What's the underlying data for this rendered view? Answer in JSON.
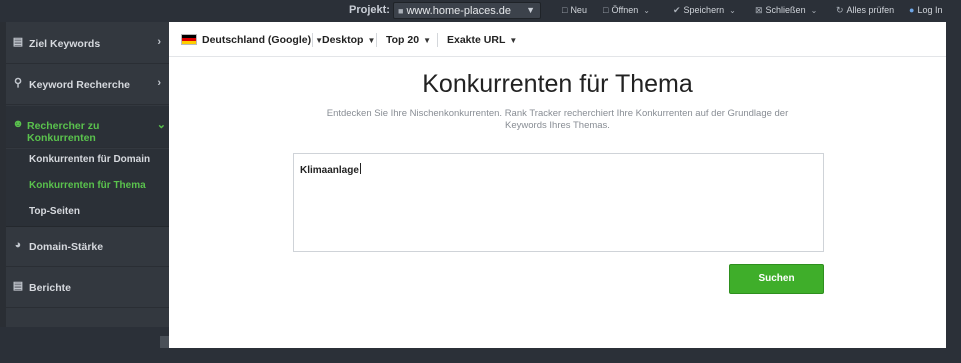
{
  "topbar": {
    "project_label": "Projekt:",
    "project_value": "www.home-places.de",
    "items": [
      {
        "label": "Neu",
        "icon": "document-icon"
      },
      {
        "label": "Öffnen",
        "icon": "folder-icon"
      },
      {
        "label": "Speichern",
        "icon": "save-icon"
      },
      {
        "label": "Schließen",
        "icon": "close-box-icon"
      },
      {
        "label": "Alles prüfen",
        "icon": "refresh-icon"
      },
      {
        "label": "Log In",
        "icon": "user-icon"
      }
    ]
  },
  "sidebar": {
    "items": [
      {
        "label": "Ziel Keywords",
        "icon": "chart-icon"
      },
      {
        "label": "Keyword Recherche",
        "icon": "search-icon"
      },
      {
        "label": "Rechercher zu Konkurrenten",
        "icon": "person-icon"
      },
      {
        "label": "Domain-Stärke",
        "icon": "gauge-icon"
      },
      {
        "label": "Berichte",
        "icon": "report-icon"
      }
    ],
    "subitems": [
      {
        "label": "Konkurrenten für Domain"
      },
      {
        "label": "Konkurrenten für Thema"
      },
      {
        "label": "Top-Seiten"
      }
    ]
  },
  "filters": {
    "country": "Deutschland (Google)",
    "device": "Desktop",
    "top": "Top 20",
    "match": "Exakte URL"
  },
  "main": {
    "title": "Konkurrenten für Thema",
    "subtitle": "Entdecken Sie Ihre Nischenkonkurrenten. Rank Tracker recherchiert Ihre Konkurrenten auf der Grundlage der Keywords Ihres Themas.",
    "keyword_value": "Klimaanlage",
    "search_label": "Suchen"
  },
  "colors": {
    "accent_green": "#3fae2a",
    "active_nav_green": "#5ac24d",
    "sidebar_bg": "#33383f",
    "topbar_bg": "#2b3038"
  }
}
